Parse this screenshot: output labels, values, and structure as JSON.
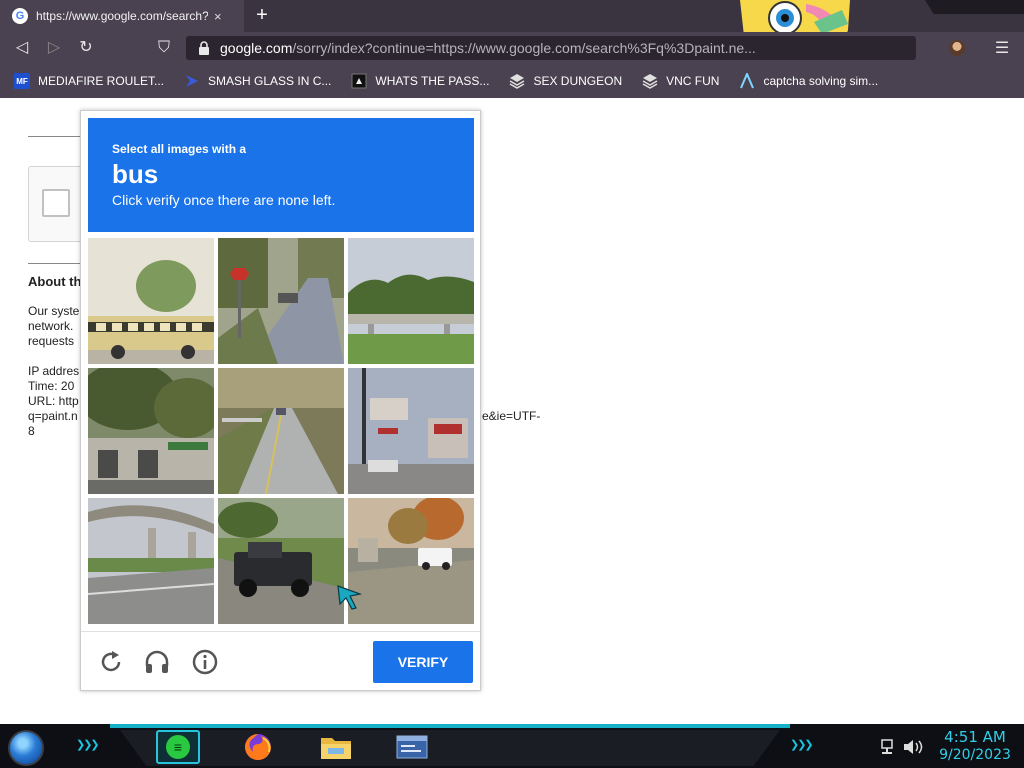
{
  "browser": {
    "tab": {
      "favicon": "G",
      "title": "https://www.google.com/search?q",
      "close": "×"
    },
    "new_tab": "+",
    "url": {
      "domain": "google.com",
      "rest": "/sorry/index?continue=https://www.google.com/search%3Fq%3Dpaint.ne..."
    },
    "nav": {
      "back": "◁",
      "forward": "▷",
      "reload": "↻",
      "bookmark": "⛉",
      "menu": "☰"
    },
    "bookmarks": [
      {
        "icon": "mediafire-icon",
        "icon_text": "MF",
        "label": "MEDIAFIRE ROULET...",
        "color": "#1d4fcf"
      },
      {
        "icon": "smash-glass-icon",
        "icon_text": "",
        "label": "SMASH GLASS IN C...",
        "color": "#3a5bd9"
      },
      {
        "icon": "password-icon",
        "icon_text": "",
        "label": "WHATS THE PASS...",
        "color": "#111111"
      },
      {
        "icon": "dungeon-icon",
        "icon_text": "",
        "label": "SEX DUNGEON",
        "color": "#e0e0e0"
      },
      {
        "icon": "vnc-icon",
        "icon_text": "",
        "label": "VNC FUN",
        "color": "#e0e0e0"
      },
      {
        "icon": "captcha-icon",
        "icon_text": "",
        "label": "captcha solving sim...",
        "color": "#7fd6ff"
      }
    ]
  },
  "page": {
    "about_heading": "About th",
    "body_lines": [
      "Our syste",
      "network.",
      "requests"
    ],
    "info_lines": [
      "IP addres",
      "Time: 20",
      "URL: http",
      "q=paint.n",
      "8"
    ],
    "url_tail": "e&ie=UTF-"
  },
  "challenge": {
    "prompt_line1": "Select all images with a",
    "prompt_target": "bus",
    "prompt_line3": "Click verify once there are none left.",
    "tiles": [
      "school-bus-tile",
      "street-stop-sign-tile",
      "overpass-trees-tile",
      "building-trees-tile",
      "road-car-tile",
      "intersection-sign-tile",
      "highway-overpass-tile",
      "pickup-truck-tile",
      "street-truck-tile"
    ],
    "verify_label": "VERIFY",
    "colors": {
      "accent": "#1a73e8"
    }
  },
  "taskbar": {
    "time": "4:51 AM",
    "date": "9/20/2023",
    "apps": [
      "notes-icon",
      "firefox-icon",
      "folder-icon",
      "window-icon"
    ],
    "notes_glyph": "≡",
    "chevrons": "❯❯❯"
  }
}
